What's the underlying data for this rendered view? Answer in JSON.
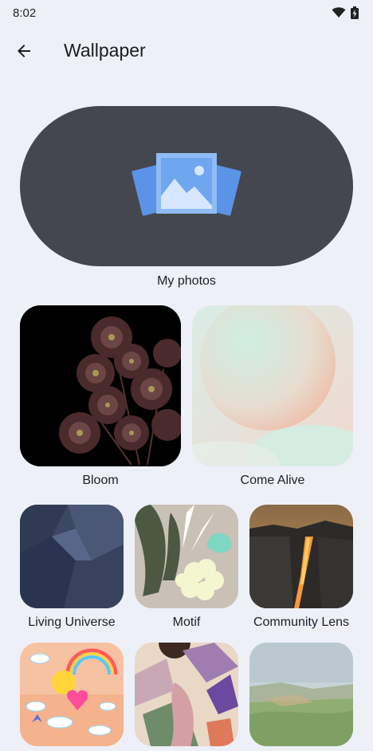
{
  "status": {
    "time": "8:02",
    "wifi_icon": "wifi-icon",
    "battery_icon": "battery-charging-icon"
  },
  "app_bar": {
    "back_icon": "arrow-back-icon",
    "title": "Wallpaper"
  },
  "my_photos": {
    "label": "My photos",
    "icon": "photo-gallery-icon"
  },
  "categories_row1": [
    {
      "label": "Bloom"
    },
    {
      "label": "Come Alive"
    }
  ],
  "categories_row2": [
    {
      "label": "Living Universe"
    },
    {
      "label": "Motif"
    },
    {
      "label": "Community Lens"
    }
  ],
  "colors": {
    "background": "#eef0f8",
    "my_photos_card": "#45474f",
    "photo_icon_blue": "#6ea6ef"
  }
}
